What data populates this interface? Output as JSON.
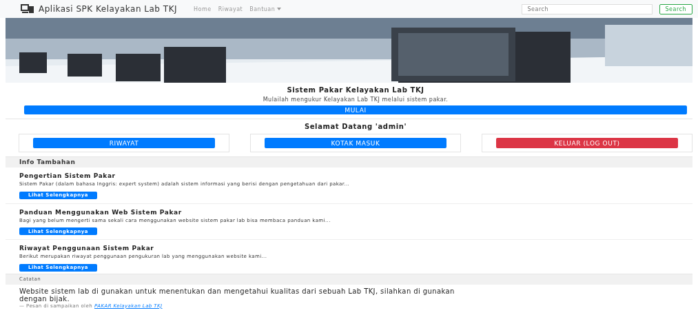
{
  "navbar": {
    "brand": "Aplikasi SPK Kelayakan Lab TKJ",
    "links": [
      {
        "label": "Home",
        "kind": "link"
      },
      {
        "label": "Riwayat",
        "kind": "link"
      },
      {
        "label": "Bantuan",
        "kind": "dropdown"
      }
    ],
    "search": {
      "placeholder": "Search",
      "button": "Search"
    }
  },
  "jumbotron": {
    "title": "Sistem Pakar Kelayakan Lab TKJ",
    "subtitle": "Mulailah mengukur Kelayakan Lab TKJ melalui sistem pakar.",
    "button": "MULAI"
  },
  "welcome": {
    "title": "Selamat Datang 'admin'",
    "buttons": [
      {
        "label": "RIWAYAT",
        "kind": "primary"
      },
      {
        "label": "KOTAK MASUK",
        "kind": "primary"
      },
      {
        "label": "KELUAR (LOG OUT)",
        "kind": "danger"
      }
    ]
  },
  "info": {
    "header": "Info Tambahan",
    "items": [
      {
        "title": "Pengertian Sistem Pakar",
        "text": "Sistem Pakar (dalam bahasa Inggris: expert system) adalah sistem informasi yang berisi dengan pengetahuan dari pakar...",
        "button": "Lihat Selengkapnya"
      },
      {
        "title": "Panduan Menggunakan Web Sistem Pakar",
        "text": "Bagi yang belum mengerti sama sekali cara menggunakan website sistem pakar lab bisa membaca panduan kami...",
        "button": "Lihat Selengkapnya"
      },
      {
        "title": "Riwayat Penggunaan Sistem Pakar",
        "text": "Berikut merupakan riwayat penggunaan pengukuran lab yang menggunakan website kami...",
        "button": "Lihat Selengkapnya"
      }
    ]
  },
  "note": {
    "header": "Catatan",
    "quote": "Website sistem lab di gunakan untuk menentukan dan mengetahui kualitas dari sebuah Lab TKJ, silahkan di gunakan dengan bijak.",
    "footer": "— Pesan di sampaikan oleh",
    "footer_link": "PAKAR Kelayakan Lab TKJ"
  }
}
